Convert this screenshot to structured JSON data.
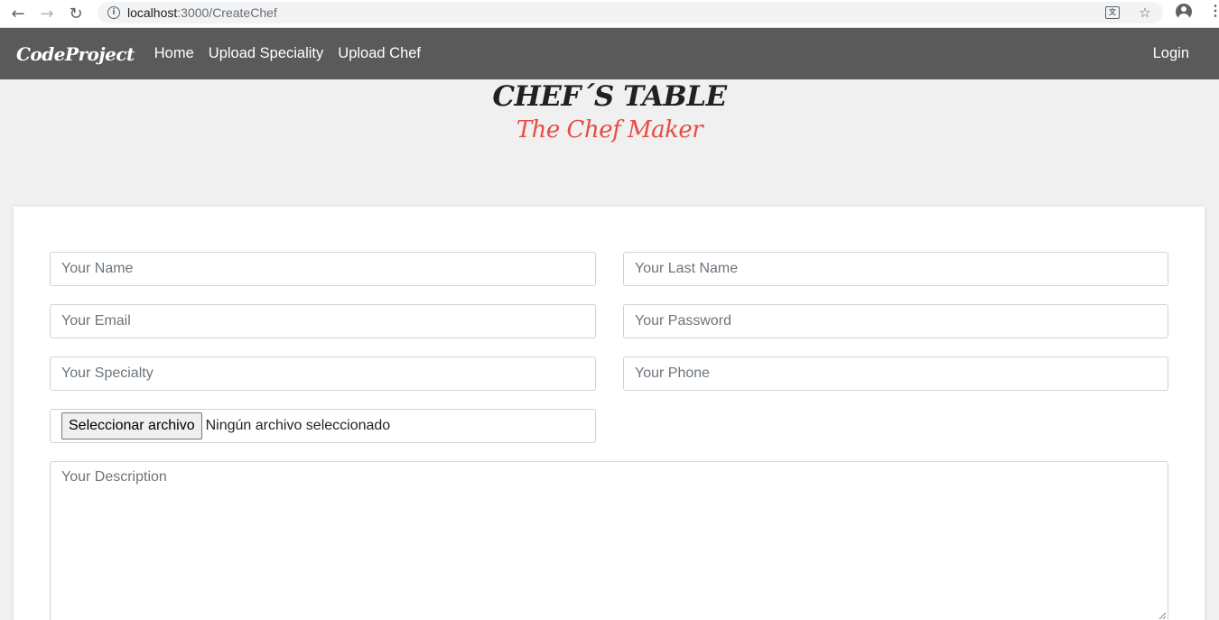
{
  "browser": {
    "url_host": "localhost",
    "url_path": ":3000/CreateChef",
    "back_icon": "arrow-left-icon",
    "forward_icon": "arrow-right-icon",
    "reload_icon": "reload-icon",
    "info_icon": "info-icon",
    "translate_icon": "translate-icon",
    "bookmark_icon": "star-icon",
    "profile_icon": "account-icon",
    "menu_icon": "kebab-menu-icon"
  },
  "navbar": {
    "brand": "CodeProject",
    "links": [
      "Home",
      "Upload Speciality",
      "Upload Chef"
    ],
    "login": "Login",
    "background": "#5a5a5a"
  },
  "hero": {
    "title": "CHEF´S TABLE",
    "subtitle": "The Chef Maker",
    "subtitle_color": "#e84b45"
  },
  "form": {
    "name_placeholder": "Your Name",
    "last_name_placeholder": "Your Last Name",
    "email_placeholder": "Your Email",
    "password_placeholder": "Your Password",
    "specialty_placeholder": "Your Specialty",
    "phone_placeholder": "Your Phone",
    "file_button": "Seleccionar archivo",
    "file_status": "Ningún archivo seleccionado",
    "description_placeholder": "Your Description"
  }
}
